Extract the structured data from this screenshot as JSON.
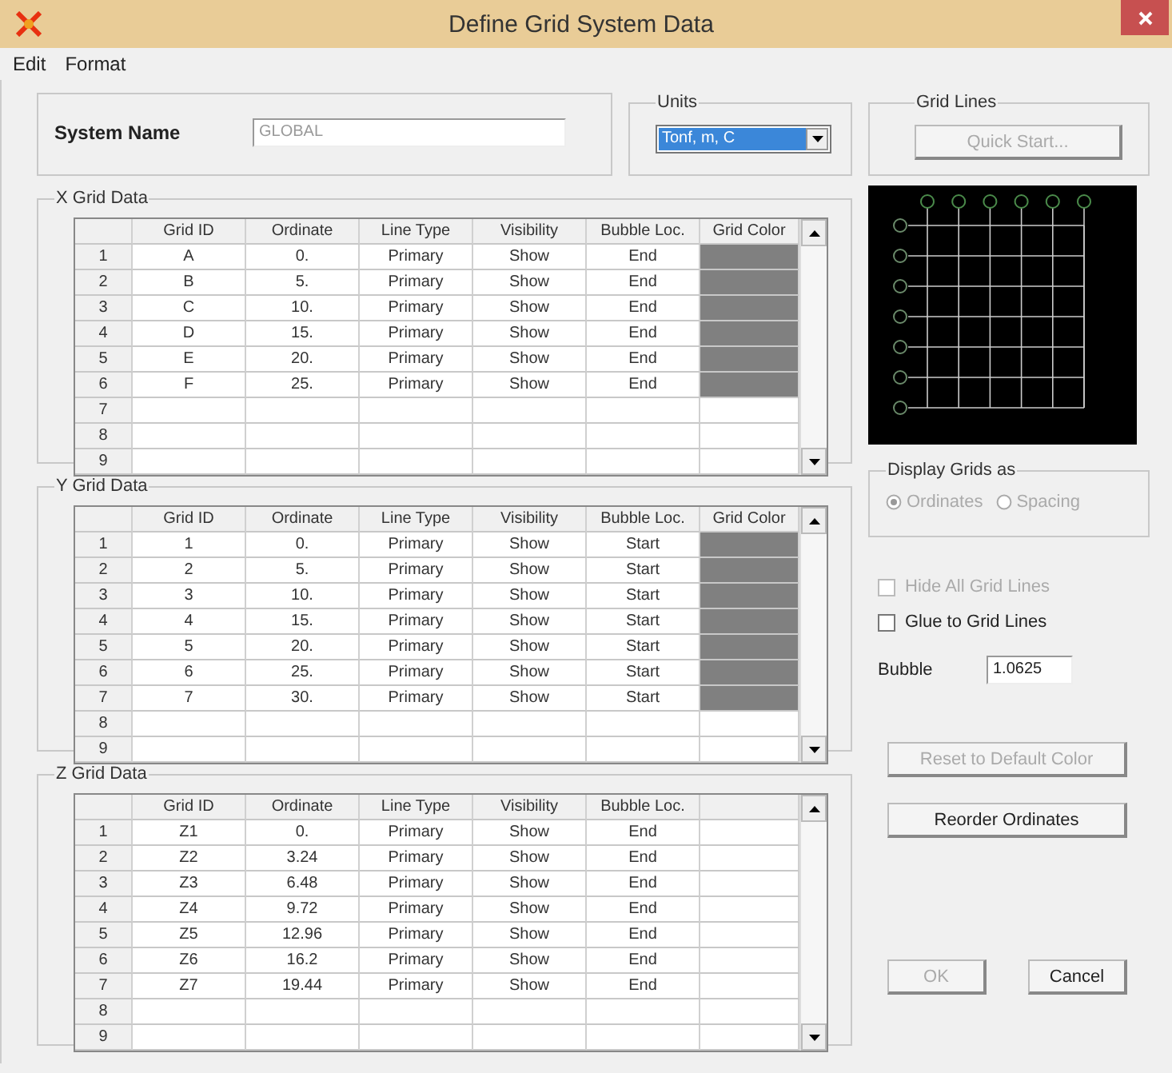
{
  "window": {
    "title": "Define Grid System Data"
  },
  "menu": [
    {
      "label": "Edit"
    },
    {
      "label": "Format"
    }
  ],
  "system": {
    "label": "System Name",
    "value": "GLOBAL",
    "disabled": true
  },
  "units": {
    "title": "Units",
    "value": "Tonf, m, C"
  },
  "grid_lines": {
    "title": "Grid Lines",
    "button": {
      "label": "Quick Start...",
      "disabled": true
    }
  },
  "grids": [
    {
      "title": "X Grid Data",
      "columns": [
        "Grid ID",
        "Ordinate",
        "Line Type",
        "Visibility",
        "Bubble Loc.",
        "Grid Color"
      ],
      "rows": [
        {
          "num": "1",
          "cells": [
            "A",
            "0.",
            "Primary",
            "Show",
            "End"
          ],
          "color": "#808080"
        },
        {
          "num": "2",
          "cells": [
            "B",
            "5.",
            "Primary",
            "Show",
            "End"
          ],
          "color": "#808080"
        },
        {
          "num": "3",
          "cells": [
            "C",
            "10.",
            "Primary",
            "Show",
            "End"
          ],
          "color": "#808080"
        },
        {
          "num": "4",
          "cells": [
            "D",
            "15.",
            "Primary",
            "Show",
            "End"
          ],
          "color": "#808080"
        },
        {
          "num": "5",
          "cells": [
            "E",
            "20.",
            "Primary",
            "Show",
            "End"
          ],
          "color": "#808080"
        },
        {
          "num": "6",
          "cells": [
            "F",
            "25.",
            "Primary",
            "Show",
            "End"
          ],
          "color": "#808080"
        },
        {
          "num": "7",
          "cells": []
        },
        {
          "num": "8",
          "cells": []
        },
        {
          "num": "9",
          "cells": []
        }
      ]
    },
    {
      "title": "Y Grid Data",
      "columns": [
        "Grid ID",
        "Ordinate",
        "Line Type",
        "Visibility",
        "Bubble Loc.",
        "Grid Color"
      ],
      "rows": [
        {
          "num": "1",
          "cells": [
            "1",
            "0.",
            "Primary",
            "Show",
            "Start"
          ],
          "color": "#808080"
        },
        {
          "num": "2",
          "cells": [
            "2",
            "5.",
            "Primary",
            "Show",
            "Start"
          ],
          "color": "#808080"
        },
        {
          "num": "3",
          "cells": [
            "3",
            "10.",
            "Primary",
            "Show",
            "Start"
          ],
          "color": "#808080"
        },
        {
          "num": "4",
          "cells": [
            "4",
            "15.",
            "Primary",
            "Show",
            "Start"
          ],
          "color": "#808080"
        },
        {
          "num": "5",
          "cells": [
            "5",
            "20.",
            "Primary",
            "Show",
            "Start"
          ],
          "color": "#808080"
        },
        {
          "num": "6",
          "cells": [
            "6",
            "25.",
            "Primary",
            "Show",
            "Start"
          ],
          "color": "#808080"
        },
        {
          "num": "7",
          "cells": [
            "7",
            "30.",
            "Primary",
            "Show",
            "Start"
          ],
          "color": "#808080"
        },
        {
          "num": "8",
          "cells": []
        },
        {
          "num": "9",
          "cells": []
        }
      ]
    },
    {
      "title": "Z Grid Data",
      "columns": [
        "Grid ID",
        "Ordinate",
        "Line Type",
        "Visibility",
        "Bubble Loc."
      ],
      "rows": [
        {
          "num": "1",
          "cells": [
            "Z1",
            "0.",
            "Primary",
            "Show",
            "End"
          ]
        },
        {
          "num": "2",
          "cells": [
            "Z2",
            "3.24",
            "Primary",
            "Show",
            "End"
          ]
        },
        {
          "num": "3",
          "cells": [
            "Z3",
            "6.48",
            "Primary",
            "Show",
            "End"
          ]
        },
        {
          "num": "4",
          "cells": [
            "Z4",
            "9.72",
            "Primary",
            "Show",
            "End"
          ]
        },
        {
          "num": "5",
          "cells": [
            "Z5",
            "12.96",
            "Primary",
            "Show",
            "End"
          ]
        },
        {
          "num": "6",
          "cells": [
            "Z6",
            "16.2",
            "Primary",
            "Show",
            "End"
          ]
        },
        {
          "num": "7",
          "cells": [
            "Z7",
            "19.44",
            "Primary",
            "Show",
            "End"
          ]
        },
        {
          "num": "8",
          "cells": []
        },
        {
          "num": "9",
          "cells": []
        }
      ]
    }
  ],
  "display_as": {
    "title": "Display Grids as",
    "options": [
      {
        "label": "Ordinates",
        "selected": true,
        "disabled": true
      },
      {
        "label": "Spacing",
        "selected": false,
        "disabled": true
      }
    ]
  },
  "checkboxes": [
    {
      "label": "Hide All Grid Lines",
      "checked": false,
      "disabled": true
    },
    {
      "label": "Glue to Grid Lines",
      "checked": false,
      "disabled": false
    }
  ],
  "bubble": {
    "label": "Bubble",
    "value": "1.0625"
  },
  "side_buttons": [
    {
      "label": "Reset to Default Color",
      "disabled": true
    },
    {
      "label": "Reorder Ordinates",
      "disabled": false
    }
  ],
  "footer_buttons": [
    {
      "label": "OK",
      "disabled": true
    },
    {
      "label": "Cancel",
      "disabled": false
    }
  ]
}
